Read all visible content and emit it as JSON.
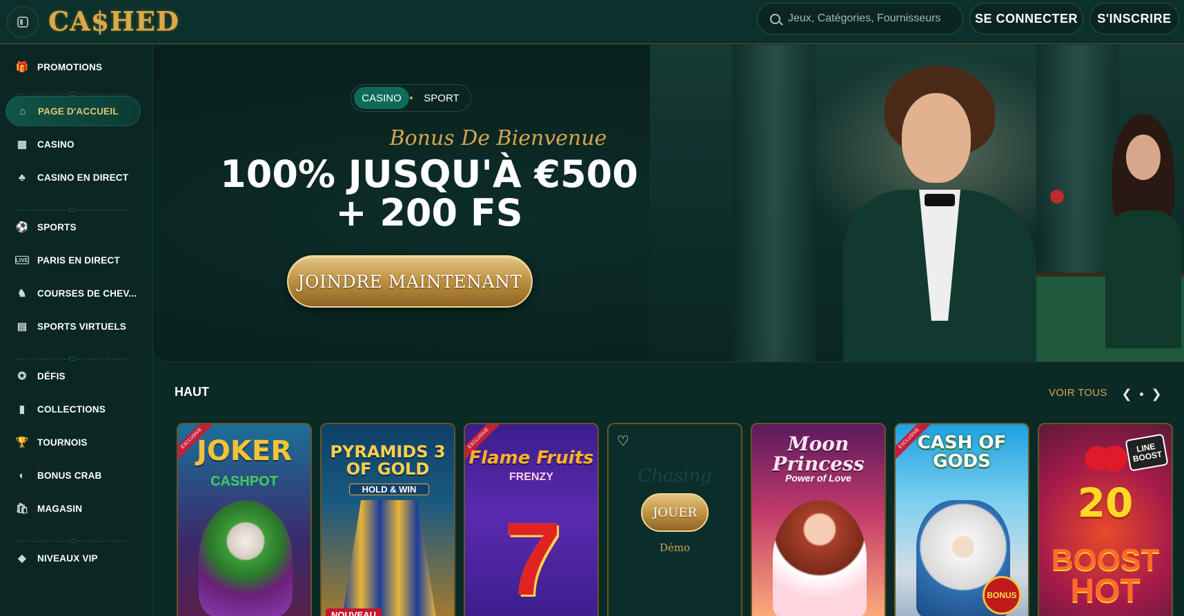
{
  "header": {
    "logo": "CA$HED",
    "search_placeholder": "Jeux, Catégories, Fournisseurs",
    "login_label": "SE CONNECTER",
    "signup_label": "S'INSCRIRE"
  },
  "sidebar": {
    "items": [
      {
        "label": "PROMOTIONS",
        "icon": "gift-icon"
      },
      {
        "label": "PAGE D'ACCUEIL",
        "icon": "home-icon"
      },
      {
        "label": "CASINO",
        "icon": "slot-icon"
      },
      {
        "label": "CASINO EN DIRECT",
        "icon": "live-cards-icon"
      },
      {
        "label": "SPORTS",
        "icon": "soccer-ball-icon"
      },
      {
        "label": "PARIS EN DIRECT",
        "icon": "live-badge-icon"
      },
      {
        "label": "COURSES DE CHEV...",
        "icon": "horse-icon"
      },
      {
        "label": "SPORTS VIRTUELS",
        "icon": "virtual-sports-icon"
      },
      {
        "label": "DÉFIS",
        "icon": "challenge-icon"
      },
      {
        "label": "COLLECTIONS",
        "icon": "collections-icon"
      },
      {
        "label": "TOURNOIS",
        "icon": "trophy-icon"
      },
      {
        "label": "BONUS CRAB",
        "icon": "crab-icon"
      },
      {
        "label": "MAGASIN",
        "icon": "shop-bag-icon"
      },
      {
        "label": "NIVEAUX VIP",
        "icon": "diamond-icon"
      }
    ]
  },
  "hero": {
    "tab_casino": "CASINO",
    "tab_sport": "SPORT",
    "subtitle": "Bonus De Bienvenue",
    "title_line1": "100% JUSQU'À €500",
    "title_line2": "+ 200 FS",
    "cta": "JOINDRE MAINTENANT"
  },
  "games": {
    "section_title": "HAUT",
    "view_all": "VOIR TOUS",
    "cards": [
      {
        "title": "JOKER",
        "subtitle": "CASHPOT",
        "ribbon": "EXCLUSIVE"
      },
      {
        "title": "PYRAMIDS 3 OF GOLD",
        "subtitle": "HOLD & WIN",
        "tag": "NOUVEAU"
      },
      {
        "title": "Flame Fruits",
        "subtitle": "FRENZY",
        "ribbon": "EXCLUSIVE"
      },
      {
        "play_label": "JOUER",
        "demo_label": "Démo"
      },
      {
        "title": "Moon Princess",
        "subtitle": "Power of Love"
      },
      {
        "title": "CASH OF GODS",
        "ribbon": "EXCLUSIVE",
        "badge": "BONUS"
      },
      {
        "title": "20",
        "subtitle": "BOOST",
        "subtitle2": "HOT",
        "badge": "LINE BOOST"
      }
    ]
  },
  "colors": {
    "accent_gold": "#d7a751",
    "background": "#0b2a26",
    "active_nav": "#0f5448"
  }
}
